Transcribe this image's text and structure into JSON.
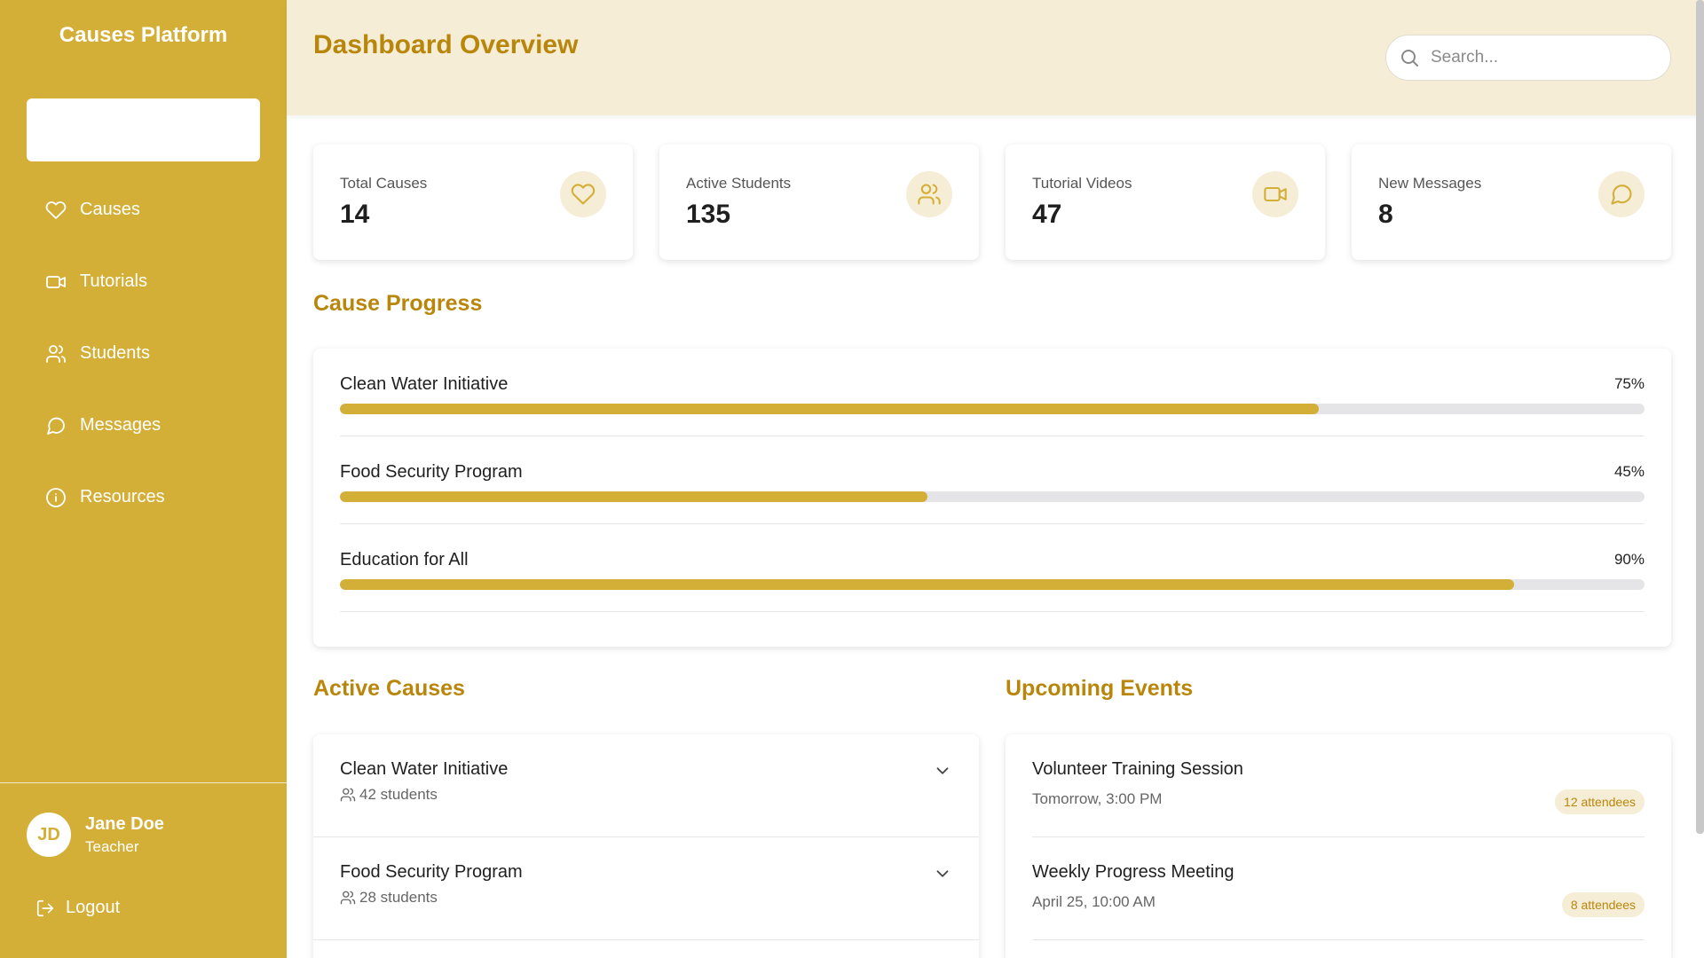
{
  "sidebar": {
    "brand": "Causes Platform",
    "items": [
      {
        "label": "Causes",
        "icon": "heart-icon"
      },
      {
        "label": "Tutorials",
        "icon": "video-icon"
      },
      {
        "label": "Students",
        "icon": "users-icon"
      },
      {
        "label": "Messages",
        "icon": "message-icon"
      },
      {
        "label": "Resources",
        "icon": "info-icon"
      }
    ],
    "user": {
      "initials": "JD",
      "name": "Jane Doe",
      "role": "Teacher"
    },
    "logout": "Logout"
  },
  "header": {
    "title": "Dashboard Overview",
    "search_placeholder": "Search..."
  },
  "stats": [
    {
      "label": "Total Causes",
      "value": "14",
      "icon": "heart-icon"
    },
    {
      "label": "Active Students",
      "value": "135",
      "icon": "users-icon"
    },
    {
      "label": "Tutorial Videos",
      "value": "47",
      "icon": "video-icon"
    },
    {
      "label": "New Messages",
      "value": "8",
      "icon": "message-icon"
    }
  ],
  "progress": {
    "title": "Cause Progress",
    "items": [
      {
        "name": "Clean Water Initiative",
        "percent_label": "75%",
        "percent": 75
      },
      {
        "name": "Food Security Program",
        "percent_label": "45%",
        "percent": 45
      },
      {
        "name": "Education for All",
        "percent_label": "90%",
        "percent": 90
      }
    ]
  },
  "active_causes": {
    "title": "Active Causes",
    "items": [
      {
        "name": "Clean Water Initiative",
        "students": "42 students"
      },
      {
        "name": "Food Security Program",
        "students": "28 students"
      }
    ]
  },
  "events": {
    "title": "Upcoming Events",
    "items": [
      {
        "name": "Volunteer Training Session",
        "time": "Tomorrow, 3:00 PM",
        "attendees": "12 attendees"
      },
      {
        "name": "Weekly Progress Meeting",
        "time": "April 25, 10:00 AM",
        "attendees": "8 attendees"
      }
    ]
  },
  "colors": {
    "accent": "#d4af37",
    "accent_dark": "#b8860b",
    "header_bg": "#f5edd6"
  }
}
